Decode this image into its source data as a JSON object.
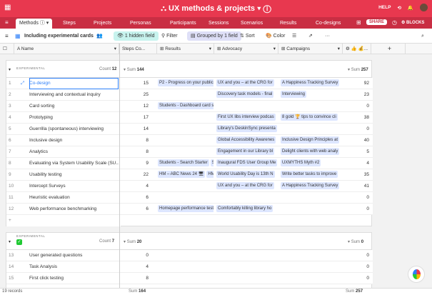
{
  "topbar": {
    "title": "UX methods & projects",
    "help": "HELP",
    "blocks": "BLOCKS",
    "share": "SHARE"
  },
  "tabs": [
    "Methods",
    "Steps",
    "Projects",
    "Personas",
    "Participants",
    "Sessions",
    "Scenarios",
    "Results",
    "Co-designs"
  ],
  "toolbar": {
    "view_name": "Including experimental cards",
    "hidden": "1 hidden field",
    "filter": "Filter",
    "grouped": "Grouped by 1 field",
    "sort": "Sort",
    "color": "Color"
  },
  "columns": [
    "Name",
    "Steps Co...",
    "Results",
    "Advocacy",
    "Campaigns",
    "👍 💰..."
  ],
  "group1": {
    "label": "EXPERIMENTAL",
    "count_label": "Count",
    "count": "12",
    "sum_label": "Sum",
    "sum": "144",
    "sum2": "257",
    "rows": [
      {
        "n": "1",
        "name": "Co-design",
        "steps": "15",
        "results": "P2 - Progress on your publics",
        "adv": "UX and you – at the CRG for",
        "camp": "A Happiness Tracking Survey",
        "val": "92"
      },
      {
        "n": "2",
        "name": "Interviewing and contextual inquiry",
        "steps": "25",
        "results": "",
        "adv": "Discovery task models - final",
        "camp": "Interviewing",
        "val": "23"
      },
      {
        "n": "3",
        "name": "Card sorting",
        "steps": "12",
        "results": "Students - Dashboard card s",
        "adv": "",
        "camp": "",
        "val": "0"
      },
      {
        "n": "4",
        "name": "Prototyping",
        "steps": "17",
        "results": "",
        "adv": "First UX libs interview podcas",
        "camp": "8 gold 🏆 tips to convince cli",
        "val": "38"
      },
      {
        "n": "5",
        "name": "Guerrilla (spontaneous) interviewing",
        "steps": "14",
        "results": "",
        "adv": "Library's DeskinSync presenta",
        "camp": "",
        "val": "0"
      },
      {
        "n": "6",
        "name": "Inclusive design",
        "steps": "8",
        "results": "",
        "adv": "Global Accessibility Awarenes",
        "camp": "Inclusive Design Principles at",
        "val": "40"
      },
      {
        "n": "7",
        "name": "Analytics",
        "steps": "8",
        "results": "",
        "adv": "Engagement in our Library bl",
        "camp": "Delight clients with web analy",
        "val": "5"
      },
      {
        "n": "8",
        "name": "Evaluating via System Usability Scale (SU...",
        "steps": "9",
        "results": "Students - Search Starter",
        "results2": "St",
        "adv": "Inaugural FDS User Group Me",
        "camp": "UXMYTHS Myth #2",
        "val": "4"
      },
      {
        "n": "9",
        "name": "Usability testing",
        "steps": "22",
        "results": "HM – ABC News 24 🖥",
        "results2": "HM -",
        "adv": "World Usability Day is 13th N",
        "camp": "Write better tasks to improve",
        "val": "35"
      },
      {
        "n": "10",
        "name": "Intercept Surveys",
        "steps": "4",
        "results": "",
        "adv": "UX and you – at the CRG for",
        "camp": "A Happiness Tracking Survey",
        "val": "41"
      },
      {
        "n": "11",
        "name": "Heuristic evaluation",
        "steps": "6",
        "results": "",
        "adv": "",
        "camp": "",
        "val": "0"
      },
      {
        "n": "12",
        "name": "Web performance benchmarking",
        "steps": "6",
        "results": "Homepage performance test",
        "adv": "Comfortably killing library ho",
        "camp": "",
        "val": "0"
      }
    ]
  },
  "group2": {
    "label": "EXPERIMENTAL",
    "count_label": "Count",
    "count": "7",
    "sum_label": "Sum",
    "sum": "20",
    "sum2": "0",
    "rows": [
      {
        "n": "13",
        "name": "User generated questions",
        "steps": "0",
        "val": "0"
      },
      {
        "n": "14",
        "name": "Task Analysis",
        "steps": "4",
        "val": "0"
      },
      {
        "n": "15",
        "name": "First click testing",
        "steps": "8",
        "val": "0"
      }
    ]
  },
  "footer": {
    "records": "19 records",
    "sum_label": "Sum",
    "sum": "164",
    "sum2": "257"
  }
}
